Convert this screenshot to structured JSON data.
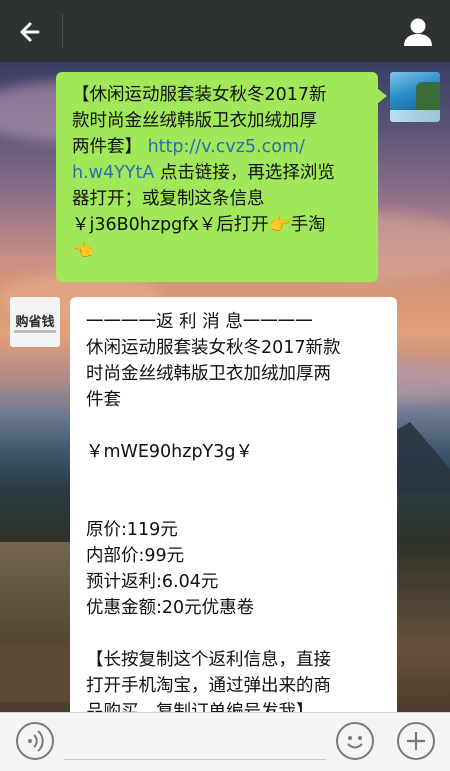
{
  "header": {
    "back_icon": "arrow-left-icon",
    "contact_icon": "person-icon"
  },
  "messages": {
    "outgoing": {
      "line1": "【休闲运动服套装女秋冬2017新",
      "line2": "款时尚金丝绒韩版卫衣加绒加厚",
      "line3_a": "两件套】",
      "line3_link": "http://v.cvz5.com/",
      "line4_link": "h.w4YYtA",
      "line4_b": " 点击链接，再选择浏览",
      "line5": "器打开；或复制这条信息",
      "line6": "￥j36B0hzpgfx￥后打开👉手淘",
      "line7": "👈"
    },
    "incoming": {
      "sender_logo": "购省钱",
      "title": "一一一一返 利 消 息一一一一",
      "product_line1": "休闲运动服套装女秋冬2017新款",
      "product_line2": "时尚金丝绒韩版卫衣加绒加厚两",
      "product_line3": "件套",
      "code": "￥mWE90hzpY3g￥",
      "original_price": "原价:119元",
      "internal_price": "内部价:99元",
      "rebate": "预计返利:6.04元",
      "coupon": "优惠金额:20元优惠卷",
      "instruction_line1": "【长按复制这个返利信息，直接",
      "instruction_line2": "打开手机淘宝，通过弹出来的商",
      "instruction_line3": "品购买，复制订单编号发我】"
    }
  },
  "input_bar": {
    "voice_icon": "voice-icon",
    "emoji_icon": "emoji-icon",
    "plus_icon": "plus-icon"
  },
  "colors": {
    "header_bg": "#2e3132",
    "outgoing_bubble": "#a0e759",
    "incoming_bubble": "#ffffff",
    "link": "#2a6fae"
  }
}
